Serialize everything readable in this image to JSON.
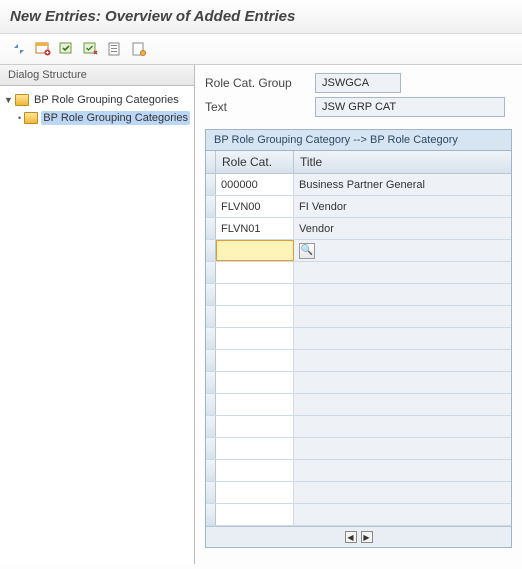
{
  "title": "New Entries: Overview of Added Entries",
  "toolbar_icon_names": [
    "settings-icon",
    "table-new-icon",
    "table-select-icon",
    "table-deselect-icon",
    "config-icon",
    "list-icon"
  ],
  "sidebar": {
    "header": "Dialog Structure",
    "nodes": [
      {
        "label": "BP Role Grouping Categories",
        "expanded": true,
        "selected": false
      },
      {
        "label": "BP Role Grouping Categories",
        "expanded": false,
        "selected": true
      }
    ]
  },
  "form": {
    "role_cat_group_label": "Role Cat. Group",
    "role_cat_group_value": "JSWGCA",
    "text_label": "Text",
    "text_value": "JSW GRP CAT"
  },
  "grid": {
    "subtitle": "BP Role Grouping Category --> BP Role Category",
    "col_a": "Role Cat.",
    "col_b": "Title",
    "rows": [
      {
        "role": "000000",
        "title": "Business Partner General"
      },
      {
        "role": "FLVN00",
        "title": "FI Vendor"
      },
      {
        "role": "FLVN01",
        "title": "Vendor"
      }
    ],
    "blank_rows": 12
  },
  "misc": {
    "search_glyph": "🔍",
    "left_glyph": "◀",
    "right_glyph": "▶",
    "chevron_down": "▼",
    "bullet": "•"
  }
}
